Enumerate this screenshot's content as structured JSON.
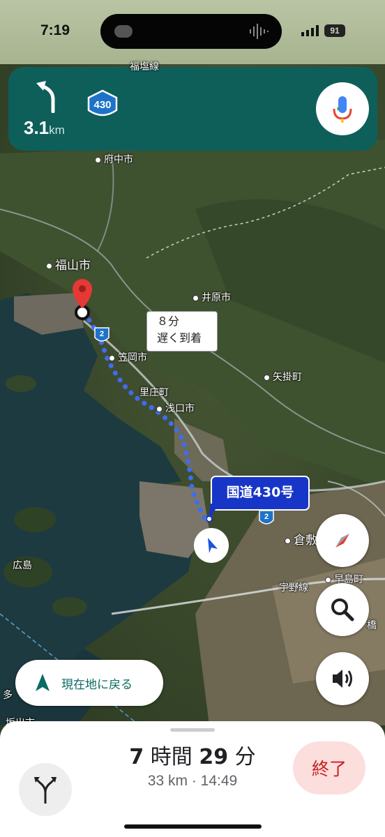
{
  "status": {
    "time": "7:19",
    "battery": "91"
  },
  "nav": {
    "distance_value": "3.1",
    "distance_unit": "km",
    "route_shield": "430",
    "turn_icon": "turn-left-arrow-icon",
    "mic_icon": "mic-icon"
  },
  "map": {
    "labels": {
      "top_city": "福塩線",
      "fuchu": "府中市",
      "fukuyama": "福山市",
      "ibara": "井原市",
      "kasaoka": "笠岡市",
      "yakage": "矢掛町",
      "satosho": "里庄町",
      "asakuchi": "浅口市",
      "kurashiki": "倉敷",
      "hiroshima_island": "広島",
      "uno_line": "宇野線",
      "hayashima": "早島町",
      "hashi": "橋",
      "ta": "多",
      "sakaide": "坂出市"
    },
    "callout": {
      "line1": "８分",
      "line2": "遅く到着"
    },
    "road_label": "国道430号",
    "route_badges": [
      "2",
      "2"
    ]
  },
  "controls": {
    "compass_icon": "compass-icon",
    "search_icon": "search-icon",
    "sound_icon": "speaker-icon",
    "recenter_label": "現在地に戻る"
  },
  "trip": {
    "eta_hours": "7",
    "eta_hours_unit": "時間",
    "eta_minutes": "29",
    "eta_minutes_unit": "分",
    "distance": "33 km",
    "separator": "·",
    "arrival": "14:49",
    "end_label": "終了"
  }
}
